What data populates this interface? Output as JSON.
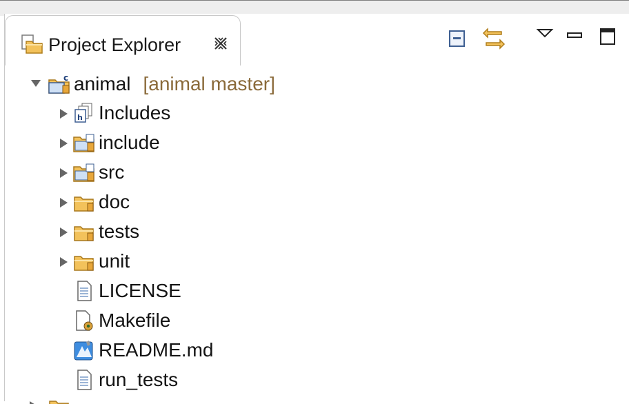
{
  "view": {
    "title": "Project Explorer",
    "toolbar": [
      {
        "icon": "collapse-all-icon"
      },
      {
        "icon": "link-with-editor-icon"
      },
      {
        "icon": "view-menu-icon"
      },
      {
        "icon": "minimize-icon"
      },
      {
        "icon": "maximize-icon"
      }
    ]
  },
  "tree": {
    "project": {
      "label": "animal",
      "decoration": "[animal master]",
      "expanded": true
    },
    "children": [
      {
        "label": "Includes",
        "icon": "includes-icon",
        "expandable": true
      },
      {
        "label": "include",
        "icon": "source-folder-icon",
        "expandable": true
      },
      {
        "label": "src",
        "icon": "source-folder-icon",
        "expandable": true
      },
      {
        "label": "doc",
        "icon": "folder-icon",
        "expandable": true
      },
      {
        "label": "tests",
        "icon": "folder-icon",
        "expandable": true
      },
      {
        "label": "unit",
        "icon": "folder-icon",
        "expandable": true
      },
      {
        "label": "LICENSE",
        "icon": "text-file-icon",
        "expandable": false
      },
      {
        "label": "Makefile",
        "icon": "makefile-icon",
        "expandable": false
      },
      {
        "label": "README.md",
        "icon": "markdown-file-icon",
        "expandable": false
      },
      {
        "label": "run_tests",
        "icon": "text-file-icon",
        "expandable": false
      }
    ]
  }
}
